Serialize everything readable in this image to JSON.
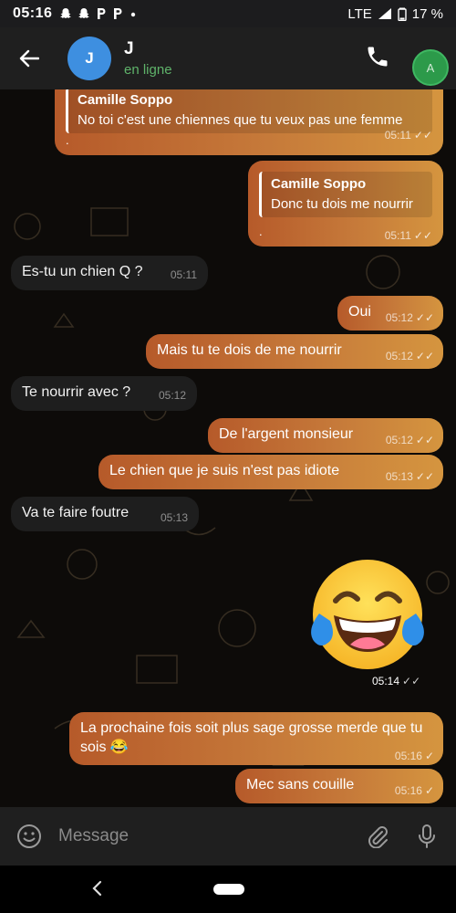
{
  "status_bar": {
    "time": "05:16",
    "notification_icons": [
      "snapchat-icon",
      "snapchat-icon",
      "parking-icon",
      "parking-icon",
      "dot-icon"
    ],
    "network": "LTE",
    "battery": "17 %"
  },
  "header": {
    "avatar_letter": "J",
    "contact_name": "J",
    "contact_status": "en ligne",
    "avatar_color": "#3e8fe0",
    "assist_label": "A"
  },
  "messages": {
    "m1": {
      "reply_name": "Camille Soppo",
      "reply_text": "No toi c'est une chiennes que tu veux pas une femme",
      "body": ".",
      "time": "05:11",
      "ticks": "✓✓"
    },
    "m2": {
      "reply_name": "Camille Soppo",
      "reply_text": "Donc tu dois me nourrir",
      "body": ".",
      "time": "05:11",
      "ticks": "✓✓"
    },
    "m3": {
      "text": "Es-tu un chien Q ?",
      "time": "05:11"
    },
    "m4": {
      "text": "Oui",
      "time": "05:12",
      "ticks": "✓✓"
    },
    "m5": {
      "text": "Mais tu te dois de me nourrir",
      "time": "05:12",
      "ticks": "✓✓"
    },
    "m6": {
      "text": "Te nourrir avec ?",
      "time": "05:12"
    },
    "m7": {
      "text": "De l'argent monsieur",
      "time": "05:12",
      "ticks": "✓✓"
    },
    "m8": {
      "text": "Le chien que je suis n'est pas idiote",
      "time": "05:13",
      "ticks": "✓✓"
    },
    "m9": {
      "text": "Va te faire foutre",
      "time": "05:13"
    },
    "m10": {
      "emoji": "😂",
      "time": "05:14",
      "ticks": "✓✓"
    },
    "m11": {
      "text": "La prochaine fois soit plus sage grosse merde que tu sois 😂",
      "time": "05:16",
      "ticks": "✓"
    },
    "m12": {
      "text": "Mec sans couille",
      "time": "05:16",
      "ticks": "✓"
    }
  },
  "input": {
    "placeholder": "Message"
  },
  "colors": {
    "outgoing_start": "#b65a2a",
    "outgoing_end": "#d5953f",
    "incoming": "#1e1e1e",
    "online": "#5fb36a"
  }
}
